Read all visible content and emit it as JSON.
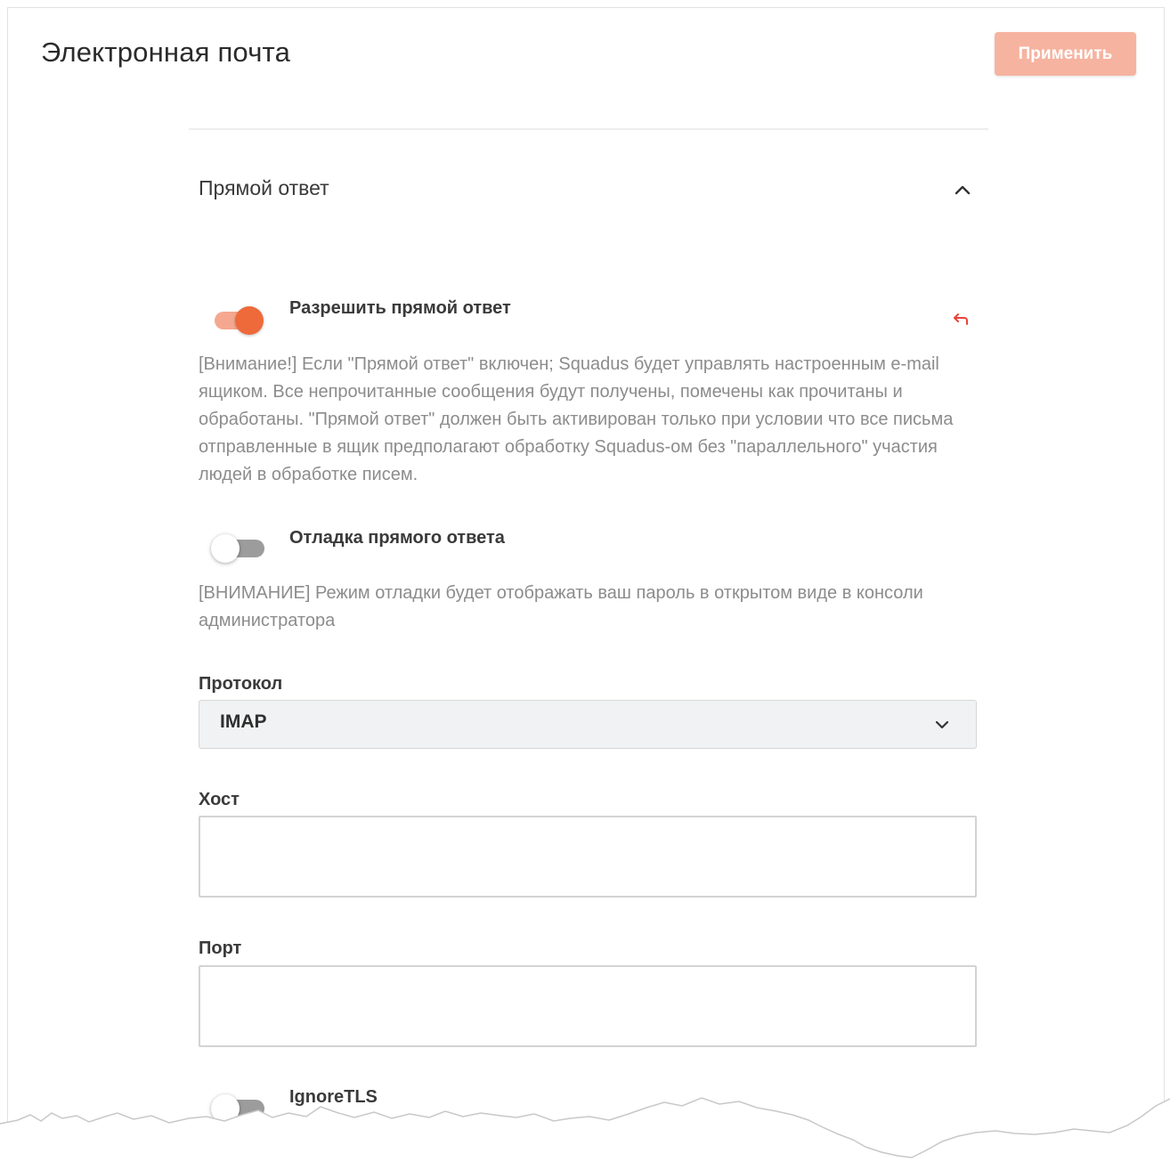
{
  "header": {
    "title": "Электронная почта",
    "apply_label": "Применить"
  },
  "section": {
    "title": "Прямой ответ",
    "expanded": true
  },
  "settings": {
    "direct_reply": {
      "label": "Разрешить прямой ответ",
      "enabled": true,
      "help": "[Внимание!] Если \"Прямой ответ\" включен; Squadus будет управлять настроенным e-mail ящиком. Все непрочитанные сообщения будут получены, помечены как прочитаны и обработаны. \"Прямой ответ\" должен быть активирован только при условии что все письма отправленные в ящик предполагают обработку Squadus-ом без \"параллельного\" участия людей в обработке писем."
    },
    "direct_reply_debug": {
      "label": "Отладка прямого ответа",
      "enabled": false,
      "help": "[ВНИМАНИЕ] Режим отладки будет отображать ваш пароль в открытом виде в консоли администратора"
    },
    "protocol": {
      "label": "Протокол",
      "value": "IMAP"
    },
    "host": {
      "label": "Хост",
      "value": ""
    },
    "port": {
      "label": "Порт",
      "value": ""
    },
    "ignore_tls": {
      "label": "IgnoreTLS",
      "enabled": false
    }
  },
  "colors": {
    "accent": "#ee6a3a",
    "accent_light": "#f5a88f",
    "apply_disabled": "#f6b3a0",
    "reset": "#e8443a"
  },
  "icons": {
    "collapse": "chevron-up-icon",
    "reset": "undo-arrow-icon",
    "select": "chevron-down-icon"
  }
}
